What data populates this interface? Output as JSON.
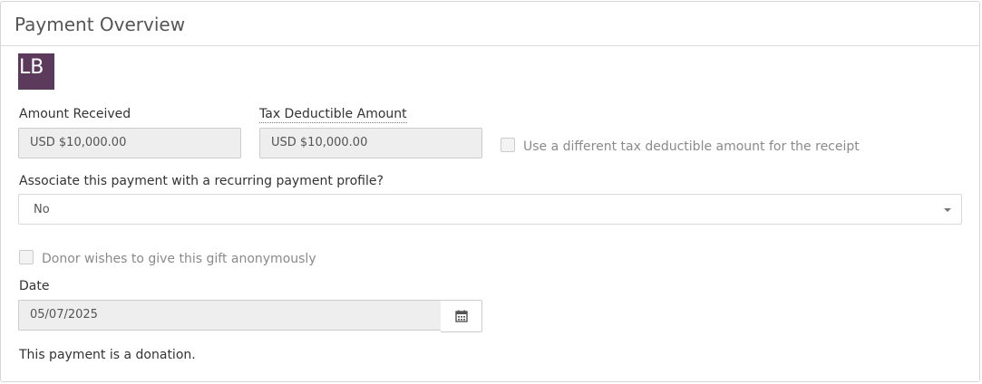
{
  "panel": {
    "title": "Payment Overview"
  },
  "avatar": {
    "initials": "LB",
    "color": "#5b3a5c"
  },
  "amount_received": {
    "label": "Amount Received",
    "value": "USD $10,000.00"
  },
  "tax_deductible": {
    "label": "Tax Deductible Amount",
    "value": "USD $10,000.00"
  },
  "different_tax_checkbox": {
    "label": "Use a different tax deductible amount for the receipt",
    "checked": false
  },
  "recurring": {
    "label": "Associate this payment with a recurring payment profile?",
    "selected": "No"
  },
  "anonymous_checkbox": {
    "label": "Donor wishes to give this gift anonymously",
    "checked": false
  },
  "date": {
    "label": "Date",
    "value": "05/07/2025",
    "button_icon": "calendar-icon"
  },
  "info": {
    "text": "This payment is a donation."
  }
}
